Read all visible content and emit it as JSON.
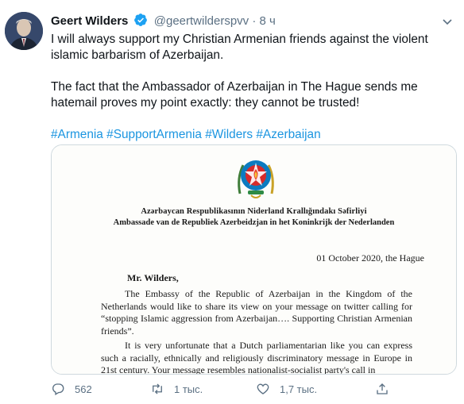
{
  "tweet": {
    "author_name": "Geert Wilders",
    "handle": "@geertwilderspvv",
    "separator": "·",
    "time": "8 ч",
    "line1": "I will always support my Christian Armenian friends against the violent islamic barbarism of Azerbaijan.",
    "line2": "The fact that the Ambassador of Azerbaijan in The Hague sends me hatemail proves my point exactly: they cannot be trusted!",
    "hashtags": [
      "#Armenia",
      "#SupportArmenia",
      "#Wilders",
      "#Azerbaijan"
    ]
  },
  "letter": {
    "heading_az": "Azərbaycan Respublikasının Niderland Krallığındakı Səfirliyi",
    "heading_nl": "Ambassade van de Republiek Azerbeidzjan in het Koninkrijk der Nederlanden",
    "date": "01 October 2020, the Hague",
    "salutation": "Mr. Wilders,",
    "para1": "The Embassy of the Republic of Azerbaijan in the Kingdom of the Netherlands would like to share its view on your message on twitter calling for “stopping Islamic aggression from Azerbaijan…. Supporting Christian Armenian friends”.",
    "para2": "It is very unfortunate that a Dutch parliamentarian like you can express such a racially, ethnically and religiously discriminatory message in Europe in 21st century. Your message resembles nationalist-socialist party's call in"
  },
  "actions": {
    "reply_count": "562",
    "retweet_count": "1 тыс.",
    "like_count": "1,7 тыс."
  },
  "colors": {
    "link": "#1b95e0",
    "secondary_text": "#5b7083",
    "verified": "#1da1f2"
  }
}
